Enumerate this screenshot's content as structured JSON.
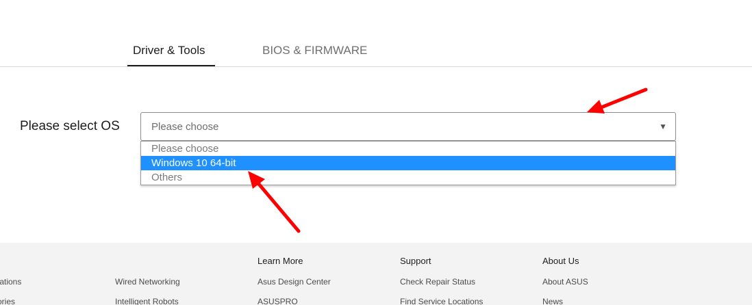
{
  "tabs": [
    {
      "label": "Driver & Tools",
      "active": true
    },
    {
      "label": "BIOS & FIRMWARE",
      "active": false
    }
  ],
  "os_select": {
    "label": "Please select OS",
    "value": "Please choose",
    "caret": "▼",
    "options": [
      "Please choose",
      "Windows 10 64-bit",
      "Others"
    ],
    "highlighted_option": "Windows 10 64-bit"
  },
  "annotations": {
    "arrow_color": "#ff0000",
    "arrow_count": 2
  },
  "footer": {
    "col0": {
      "links": [
        "tations",
        "ories"
      ]
    },
    "col1": {
      "links": [
        "Wired Networking",
        "Intelligent Robots"
      ]
    },
    "col2": {
      "heading": "Learn More",
      "links": [
        "Asus Design Center",
        "ASUSPRO"
      ]
    },
    "col3": {
      "heading": "Support",
      "links": [
        "Check Repair Status",
        "Find Service Locations"
      ]
    },
    "col4": {
      "heading": "About Us",
      "links": [
        "About ASUS",
        "News"
      ]
    }
  },
  "colors": {
    "highlight": "#1e90ff",
    "footer_bg": "#f3f3f3"
  }
}
